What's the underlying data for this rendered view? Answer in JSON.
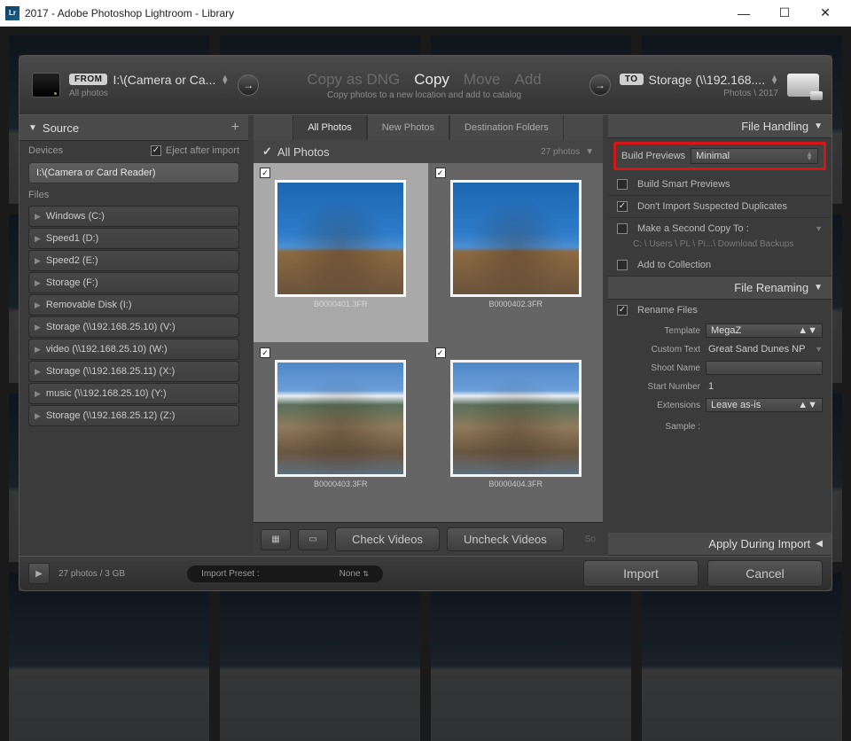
{
  "window": {
    "icon_text": "Lr",
    "title": "2017 - Adobe Photoshop Lightroom - Library"
  },
  "top": {
    "from_badge": "FROM",
    "from_src": "I:\\(Camera or Ca...",
    "from_sub": "All photos",
    "to_badge": "TO",
    "actions": {
      "copy_dng": "Copy as DNG",
      "copy": "Copy",
      "move": "Move",
      "add": "Add"
    },
    "sub": "Copy photos to a new location and add to catalog",
    "to_dest": "Storage (\\\\192.168....",
    "to_sub": "Photos \\ 2017"
  },
  "left": {
    "title": "Source",
    "devices_label": "Devices",
    "eject_label": "Eject after import",
    "device": "I:\\(Camera or Card Reader)",
    "files_label": "Files",
    "drives": [
      "Windows (C:)",
      "Speed1 (D:)",
      "Speed2 (E:)",
      "Storage (F:)",
      "Removable Disk (I:)",
      "Storage (\\\\192.168.25.10) (V:)",
      "video (\\\\192.168.25.10) (W:)",
      "Storage (\\\\192.168.25.11) (X:)",
      "music (\\\\192.168.25.10) (Y:)",
      "Storage (\\\\192.168.25.12) (Z:)"
    ]
  },
  "center": {
    "tabs": {
      "all": "All Photos",
      "new": "New Photos",
      "dest": "Destination Folders"
    },
    "grid_title": "All Photos",
    "count": "27 photos",
    "check": "Check Videos",
    "uncheck": "Uncheck Videos",
    "sort_hint": "So",
    "files": [
      "B0000401.3FR",
      "B0000402.3FR",
      "B0000403.3FR",
      "B0000404.3FR"
    ]
  },
  "right": {
    "file_handling": "File Handling",
    "build_previews_label": "Build Previews",
    "build_previews_value": "Minimal",
    "smart": "Build Smart Previews",
    "dup": "Don't Import Suspected Duplicates",
    "second": "Make a Second Copy To :",
    "second_path": "C: \\ Users \\ PL \\ Pi...\\ Download Backups",
    "collection": "Add to Collection",
    "file_renaming": "File Renaming",
    "rename": "Rename Files",
    "template_label": "Template",
    "template_value": "MegaZ",
    "custom_label": "Custom Text",
    "custom_value": "Great Sand Dunes NP",
    "shootname_label": "Shoot Name",
    "startnum_label": "Start Number",
    "startnum_value": "1",
    "ext_label": "Extensions",
    "ext_value": "Leave as-is",
    "sample_label": "Sample :",
    "apply": "Apply During Import"
  },
  "bottom": {
    "status": "27 photos / 3 GB",
    "preset_label": "Import Preset :",
    "preset_value": "None",
    "import": "Import",
    "cancel": "Cancel"
  }
}
